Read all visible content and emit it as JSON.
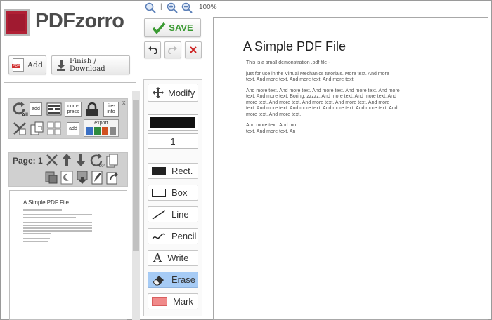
{
  "app": {
    "name": "PDFzorro"
  },
  "zoom": {
    "level": "100%",
    "separator": "|"
  },
  "buttons": {
    "add": "Add",
    "finish": "Finish / Download",
    "save": "SAVE",
    "pdf_badge": "PDF"
  },
  "tools_panel": {
    "close": "x",
    "all": "All",
    "add_top": "add",
    "compress": "com-press",
    "file_info": "file-info",
    "add_bottom": "add",
    "export": "export"
  },
  "page_panel": {
    "label": "Page: 1",
    "rotate_label": "90°"
  },
  "thumbnail": {
    "title": "A Simple PDF File"
  },
  "drawing_tools": {
    "modify": "Modify",
    "stroke_width": "1",
    "rect": "Rect.",
    "box": "Box",
    "line": "Line",
    "pencil": "Pencil",
    "write": "Write",
    "write_glyph": "A",
    "erase": "Erase",
    "mark": "Mark",
    "active": "erase",
    "color_value": "#111111",
    "active_bg": "#a6cbf5"
  },
  "document": {
    "title": "A Simple PDF File",
    "paragraphs": [
      "This is a small demonstration .pdf file -",
      "just for use in the Virtual Mechanics tutorials. More text. And more\ntext. And more text. And more text. And more text.",
      "And more text. And more text. And more text. And more text. And more\ntext. And more text. Boring, zzzzz. And more text. And more text. And\nmore text. And more text. And more text. And more text. And more\ntext. And more text. And more text. And more text. And more text. And\nmore text. And more text.",
      "And more text. And mo\ntext. And more text. An"
    ]
  },
  "colors": {
    "save_green": "#3a9a32",
    "logo_red": "#b02035",
    "undo_red": "#cc2222"
  }
}
